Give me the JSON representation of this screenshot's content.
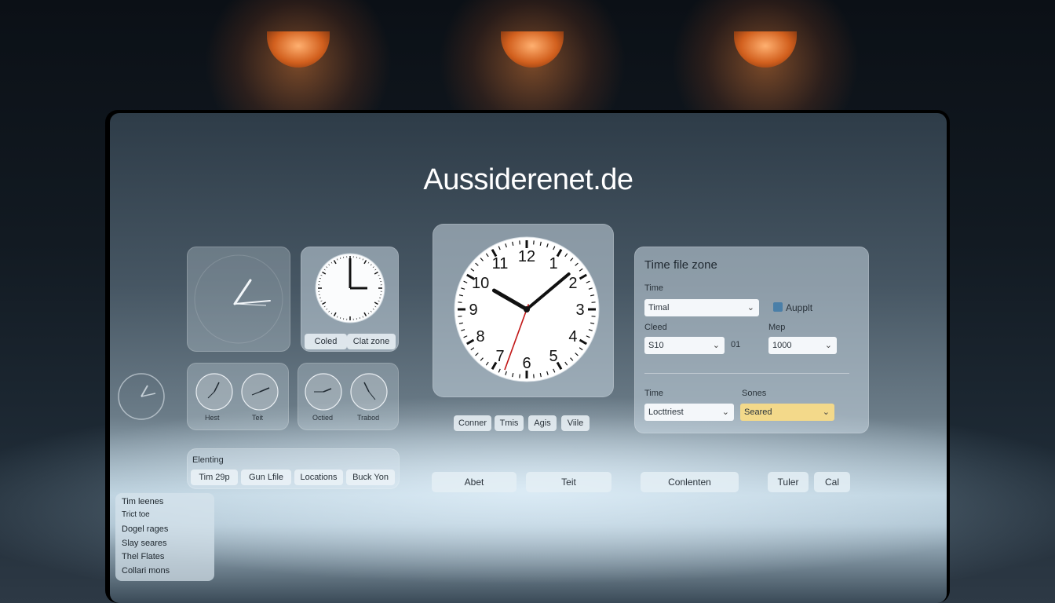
{
  "site_title": "Aussiderenet.de",
  "small_clock_cards": {
    "top_right_buttons": [
      "Coled",
      "Clat zone"
    ],
    "pair_left_labels": [
      "Hest",
      "Teit"
    ],
    "pair_right_labels": [
      "Octied",
      "Trabod"
    ]
  },
  "main_clock": {
    "numerals": [
      "12",
      "1",
      "2",
      "3",
      "4",
      "5",
      "6",
      "7",
      "8",
      "9",
      "10",
      "11"
    ],
    "hour_hand_deg": 300,
    "minute_hand_deg": 50,
    "second_hand_deg": 200
  },
  "main_clock_chips": [
    "Conner",
    "Tmis",
    "Agis",
    "Viile"
  ],
  "search_panel": {
    "label": "Elenting",
    "chips": [
      "Tim 29p",
      "Gun Lfile",
      "Locations",
      "Buck Yon"
    ]
  },
  "bottom_buttons": [
    "Abet",
    "Teit",
    "Conlenten",
    "Tuler",
    "Cal"
  ],
  "side_list": [
    "Tim leenes",
    "Trict toe",
    "Dogel rages",
    "Slay seares",
    "Thel Flates",
    "Collari mons"
  ],
  "timezone_panel": {
    "title": "Time file zone",
    "time_label": "Time",
    "time_value": "Timal",
    "checkbox_label": "Aupplt",
    "cleed_label": "Cleed",
    "cleed_value": "S10",
    "cleed_suffix": "01",
    "map_label": "Mep",
    "map_value": "1000",
    "time2_label": "Time",
    "time2_value": "Locttriest",
    "sones_label": "Sones",
    "sones_value": "Seared"
  },
  "colors": {
    "lamp": "#e07030",
    "accent_select": "#f3d98a",
    "checkbox": "#4a7fa8"
  }
}
